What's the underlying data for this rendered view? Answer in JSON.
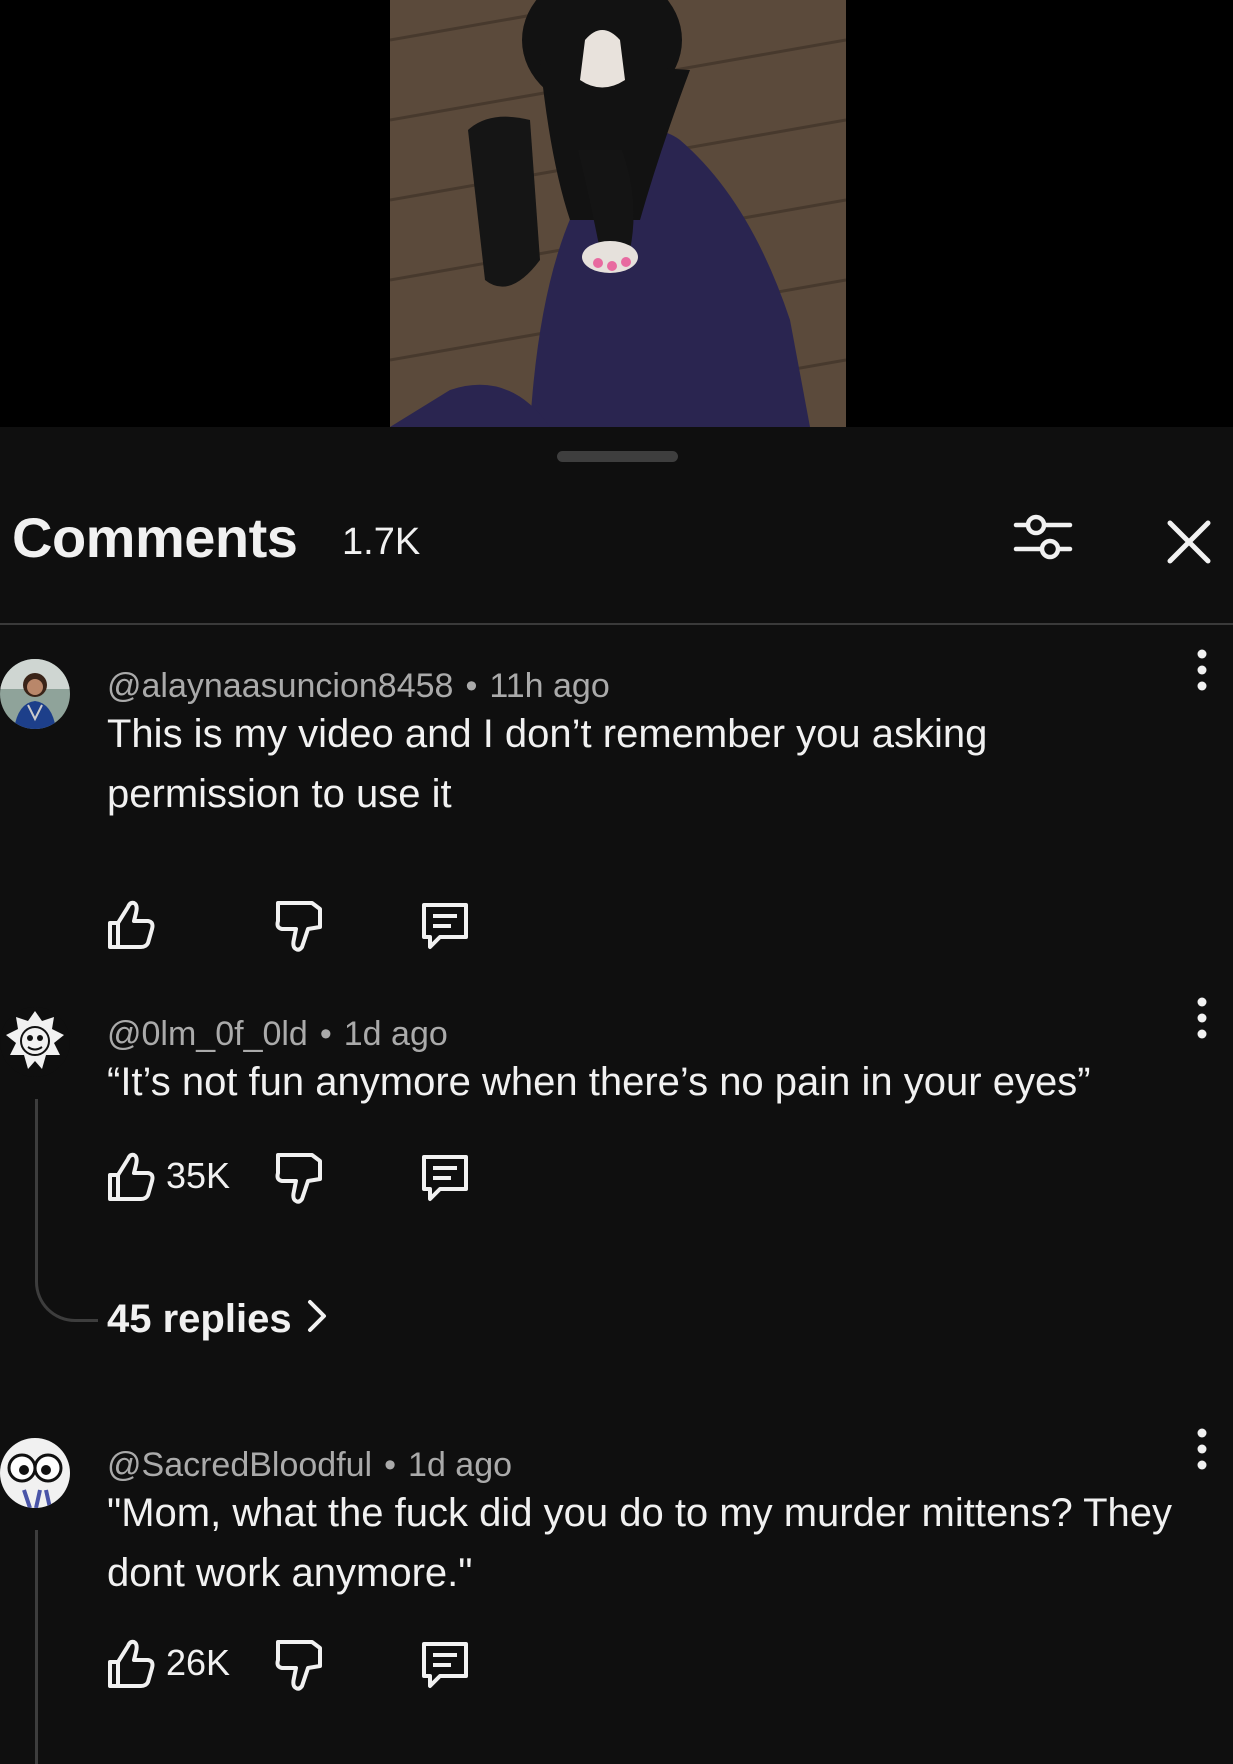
{
  "comments_panel": {
    "title": "Comments",
    "count": "1.7K"
  },
  "icons": {
    "filter": "sliders-icon",
    "close": "close-icon",
    "more": "more-vert-icon",
    "like": "thumbs-up-icon",
    "dislike": "thumbs-down-icon",
    "reply": "reply-icon",
    "chevron": "chevron-right-icon"
  },
  "comments": [
    {
      "author": "@alaynaasuncion8458",
      "time": "11h ago",
      "separator": "•",
      "text": "This is my video and I don’t remember you asking permission to use it",
      "likes": ""
    },
    {
      "author": "@0lm_0f_0ld",
      "time": "1d ago",
      "separator": "•",
      "text": "“It’s not fun anymore when there’s no pain in your eyes”",
      "likes": "35K",
      "replies": "45 replies"
    },
    {
      "author": "@SacredBloodful",
      "time": "1d ago",
      "separator": "•",
      "text": "\"Mom, what the fuck did you do to my murder mittens? They dont work anymore.\"",
      "likes": "26K"
    }
  ],
  "colors": {
    "background": "#0f0f0f",
    "text": "#f1f1f1",
    "meta_text": "#aaaaaa",
    "divider": "#3a3a3a"
  }
}
